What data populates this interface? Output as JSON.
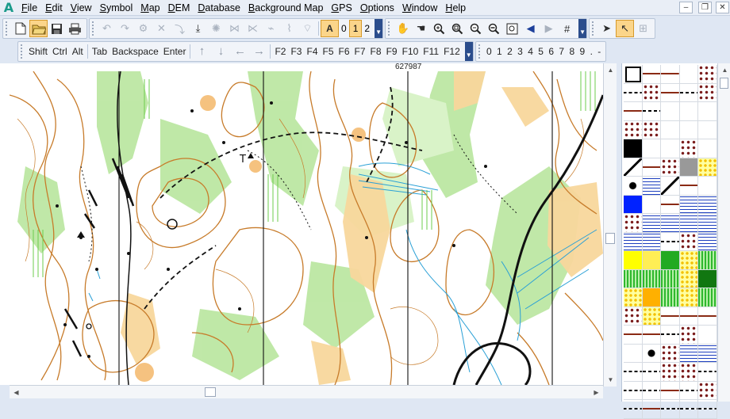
{
  "app": {
    "logo": "A"
  },
  "menu": [
    "File",
    "Edit",
    "View",
    "Symbol",
    "Map",
    "DEM",
    "Database",
    "Background Map",
    "GPS",
    "Options",
    "Window",
    "Help"
  ],
  "window_controls": {
    "minimize": "–",
    "restore": "❐",
    "close": "✕"
  },
  "toolbar1": {
    "file_icons": [
      "new-file-icon",
      "open-folder-icon",
      "save-icon",
      "print-icon"
    ],
    "edit_icons": [
      "undo-icon",
      "redo-icon",
      "tool-a-icon",
      "tool-b-icon",
      "tool-c-icon",
      "tool-d-icon",
      "tool-e-icon",
      "tool-f-icon",
      "tool-g-icon",
      "tool-h-icon",
      "tool-i-icon",
      "tool-j-icon"
    ],
    "draw_mode_label": "A",
    "modes": [
      "0",
      "1",
      "2"
    ],
    "active_mode": "1",
    "view_icons": [
      "hand-icon",
      "pan-icon",
      "zoom-in-icon",
      "zoom-fit-icon",
      "zoom-out-icon",
      "zoom-out-alt-icon",
      "zoom-window-icon",
      "back-icon",
      "forward-icon",
      "grid-icon"
    ],
    "select_icons": [
      "arrow-icon",
      "select-icon",
      "edit-point-icon"
    ]
  },
  "toolbar2": {
    "modifier_keys": [
      "Shift",
      "Ctrl",
      "Alt"
    ],
    "special_keys": [
      "Tab",
      "Backspace",
      "Enter"
    ],
    "arrows": [
      "↑",
      "↓",
      "←",
      "→"
    ],
    "function_keys": [
      "F2",
      "F3",
      "F4",
      "F5",
      "F6",
      "F7",
      "F8",
      "F9",
      "F10",
      "F11",
      "F12"
    ],
    "numeric_keys": [
      "0",
      "1",
      "2",
      "3",
      "4",
      "5",
      "6",
      "7",
      "8",
      "9",
      ".",
      "-"
    ]
  },
  "map": {
    "coordinate": "627987"
  },
  "palette": {
    "selected_index": 0,
    "tiles": [
      "frame",
      "line-brown",
      "line-dash-brown",
      "label-800",
      "dot-small",
      "dash-brown",
      "dot-line",
      "line-brown-thin",
      "dash-fine",
      "dots-row",
      "line-red",
      "dash-red",
      "arc",
      "v-shape",
      "tick-line",
      "dot-brown",
      "dots-scatter",
      "cross",
      "comb",
      "thick-black",
      "square-black",
      "comb-fine",
      "v-small",
      "dot-black",
      "slash",
      "triangle-small",
      "line-black",
      "dot-black",
      "gray",
      "yellow-dot",
      "circle-black",
      "blue-dash",
      "triangle-black",
      "line-thick",
      "ellipse-red",
      "blue",
      "arrow-black",
      "line-dark",
      "v-blue",
      "dash-blue",
      "dots-black",
      "stripes-blue",
      "line-blue",
      "stripes-blue2",
      "circle-blue",
      "dash-blue2",
      "arc-blue",
      "dash-thin",
      "dots-thin",
      "blue-stripes3",
      "yellow",
      "yellow-light",
      "green",
      "yellow-dots",
      "green-dots",
      "green-stripes",
      "green-stripe-light",
      "green-v",
      "yellow-green",
      "dark-green",
      "yellow-stripes",
      "orange",
      "green-dots2",
      "yellow-dots2",
      "green-fine",
      "dot-green",
      "yellow-stipple",
      "line-orange",
      "line-gray",
      "line-gray2",
      "line-black2",
      "line-black3",
      "dash-black",
      "dots-black2",
      "orange-dots",
      "cross-green",
      "circle-green",
      "dot-green2",
      "stripes-dark",
      "stripes-red",
      "dash-row",
      "dash-row2",
      "dots-row2",
      "dot-grid",
      "dash-row3",
      "dash-row4",
      "dash-thick",
      "line-thin2",
      "dash-row5",
      "dots-row3",
      "dash-thick2",
      "line-thin3",
      "dash-thin2",
      "dash-thin3",
      "dash-thin4"
    ]
  }
}
